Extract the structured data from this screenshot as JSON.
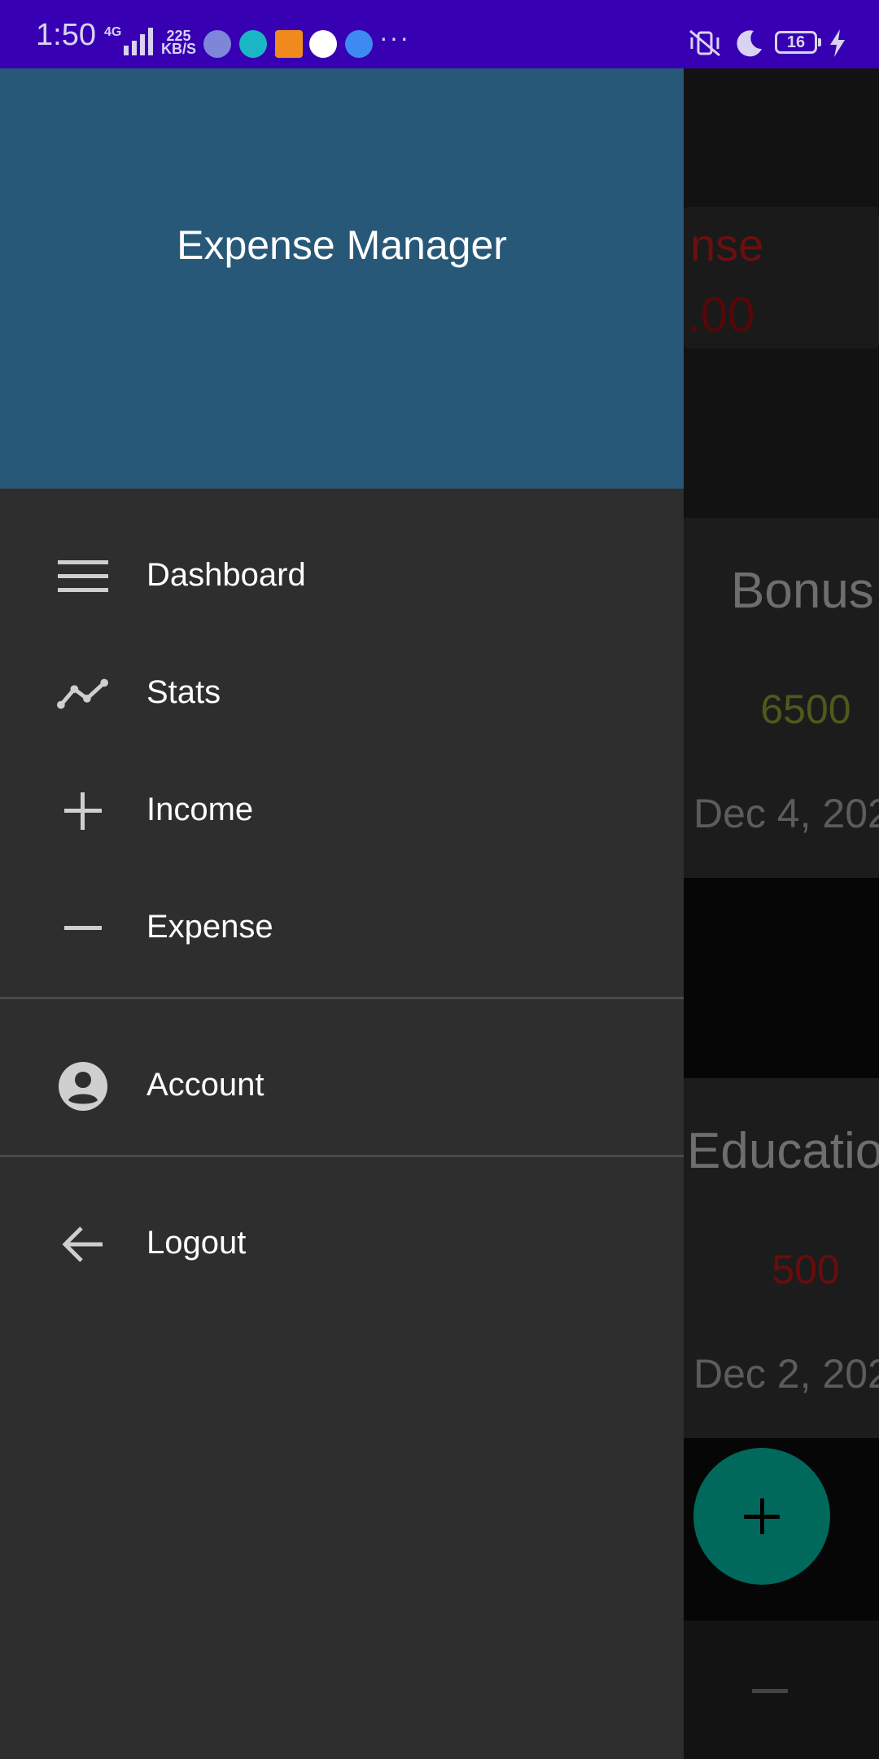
{
  "status_bar": {
    "time": "1:50",
    "network": "4G",
    "speed_value": "225",
    "speed_unit": "KB/S",
    "more": "···",
    "battery": "16",
    "app_icons": [
      "discord-icon",
      "app-icon-2",
      "app-icon-3",
      "app-icon-4",
      "play-icon"
    ],
    "right_icons": [
      "vibrate-icon",
      "moon-icon",
      "battery-icon",
      "charging-icon"
    ]
  },
  "background": {
    "summary_title": "nse",
    "summary_amount": ".00",
    "transactions": [
      {
        "category": "Bonus",
        "amount": "6500",
        "date": "Dec 4, 202",
        "amount_color": "#4d5a1a"
      },
      {
        "category": "Educatio",
        "amount": "500",
        "date": "Dec 2, 202",
        "amount_color": "#6b0c0c"
      }
    ],
    "fab_icon": "plus-icon",
    "bottom_icon": "minus-icon"
  },
  "drawer": {
    "title": "Expense Manager",
    "header_color": "#285878",
    "items": [
      {
        "label": "Dashboard",
        "icon": "menu-icon"
      },
      {
        "label": "Stats",
        "icon": "chart-line-icon"
      },
      {
        "label": "Income",
        "icon": "plus-icon"
      },
      {
        "label": "Expense",
        "icon": "minus-icon"
      },
      {
        "label": "Account",
        "icon": "account-circle-icon"
      },
      {
        "label": "Logout",
        "icon": "arrow-back-icon"
      }
    ]
  }
}
